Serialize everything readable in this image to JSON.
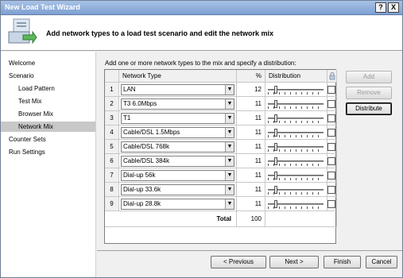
{
  "window": {
    "title": "New Load Test Wizard",
    "help_label": "?",
    "close_label": "X"
  },
  "header": {
    "title": "Add network types to a load test scenario and edit the network mix",
    "icon": "wizard-icon"
  },
  "nav": {
    "items": [
      {
        "label": "Welcome"
      },
      {
        "label": "Scenario"
      },
      {
        "label": "Load Pattern"
      },
      {
        "label": "Test Mix"
      },
      {
        "label": "Browser Mix"
      },
      {
        "label": "Network Mix"
      },
      {
        "label": "Counter Sets"
      },
      {
        "label": "Run Settings"
      }
    ],
    "selected": "Network Mix"
  },
  "content": {
    "instruction": "Add one or more network types to the mix and specify a distribution:",
    "columns": {
      "type": "Network Type",
      "percent": "%",
      "distribution": "Distribution"
    },
    "rows": [
      {
        "num": "1",
        "type": "LAN",
        "percent": "12",
        "level": 0.12
      },
      {
        "num": "2",
        "type": "T3 6.0Mbps",
        "percent": "11",
        "level": 0.11
      },
      {
        "num": "3",
        "type": "T1",
        "percent": "11",
        "level": 0.11
      },
      {
        "num": "4",
        "type": "Cable/DSL 1.5Mbps",
        "percent": "11",
        "level": 0.11
      },
      {
        "num": "5",
        "type": "Cable/DSL 768k",
        "percent": "11",
        "level": 0.11
      },
      {
        "num": "6",
        "type": "Cable/DSL 384k",
        "percent": "11",
        "level": 0.11
      },
      {
        "num": "7",
        "type": "Dial-up 56k",
        "percent": "11",
        "level": 0.11
      },
      {
        "num": "8",
        "type": "Dial-up 33.6k",
        "percent": "11",
        "level": 0.11
      },
      {
        "num": "9",
        "type": "Dial-up 28.8k",
        "percent": "11",
        "level": 0.11
      }
    ],
    "total_label": "Total",
    "total_value": "100"
  },
  "side_buttons": {
    "add": {
      "label": "Add",
      "enabled": false
    },
    "remove": {
      "label": "Remove",
      "enabled": false
    },
    "distribute": {
      "label": "Distribute",
      "enabled": true
    }
  },
  "footer": {
    "previous": "< Previous",
    "next": "Next >",
    "finish": "Finish",
    "cancel": "Cancel"
  }
}
